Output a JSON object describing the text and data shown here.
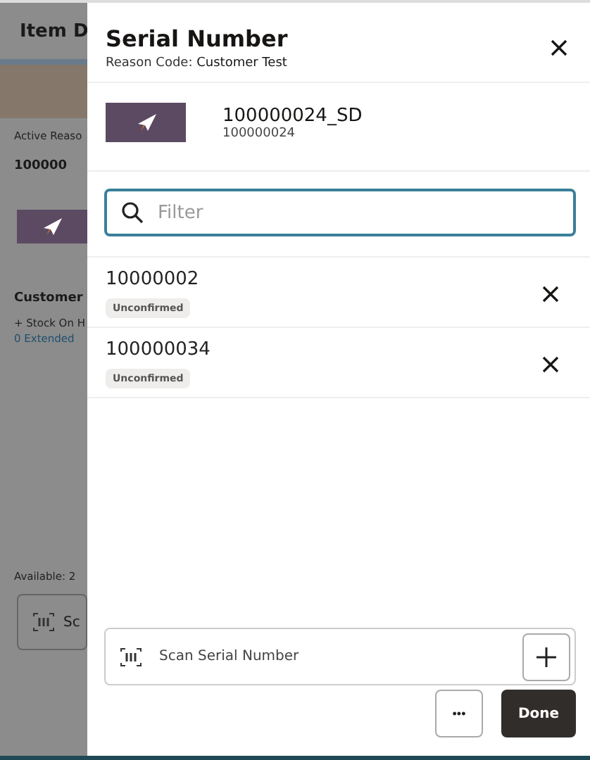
{
  "background_page": {
    "title": "Item D",
    "reason_label": "Active Reaso",
    "item_number": "100000",
    "section_title": "Customer",
    "stock_link": "+ Stock On H",
    "extended_link": "0 Extended",
    "available": "Available: 2",
    "scan_button": "Sc"
  },
  "drawer": {
    "title": "Serial Number",
    "subtitle_label": "Reason Code:",
    "subtitle_value": "Customer Test",
    "item": {
      "name": "100000024_SD",
      "number": "100000024"
    },
    "filter": {
      "placeholder": "Filter"
    },
    "serials": [
      {
        "number": "10000002",
        "status": "Unconfirmed"
      },
      {
        "number": "100000034",
        "status": "Unconfirmed"
      }
    ],
    "scan_field": {
      "placeholder": "Scan Serial Number"
    },
    "more_button": "•••",
    "done_button": "Done"
  }
}
